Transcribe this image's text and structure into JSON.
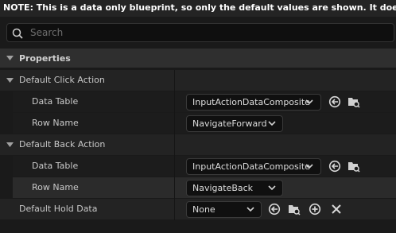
{
  "note": "NOTE: This is a data only blueprint, so only the default values are shown.  It does not have any script or variables.  If you want to add some, Open Full Blueprint Editor",
  "search": {
    "placeholder": "Search"
  },
  "category": {
    "label": "Properties"
  },
  "default_click_action": {
    "label": "Default Click Action",
    "data_table_label": "Data Table",
    "data_table_value": "InputActionDataComposite",
    "row_name_label": "Row Name",
    "row_name_value": "NavigateForward"
  },
  "default_back_action": {
    "label": "Default Back Action",
    "data_table_label": "Data Table",
    "data_table_value": "InputActionDataComposite",
    "row_name_label": "Row Name",
    "row_name_value": "NavigateBack"
  },
  "default_hold_data": {
    "label": "Default Hold Data",
    "value": "None"
  },
  "colors": {
    "background": "#1a1a1a",
    "field": "#101010",
    "text": "#c8c8c8"
  }
}
